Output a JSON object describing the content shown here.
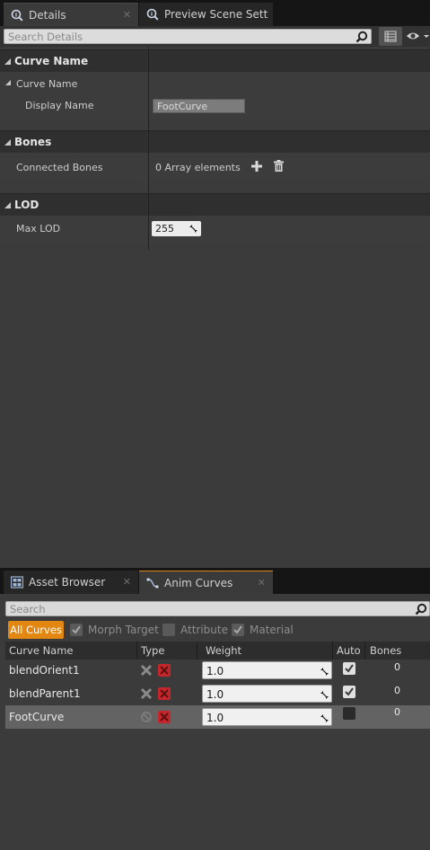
{
  "top_tabs": [
    {
      "label": "Details",
      "icon": "details-info-icon",
      "active": true
    },
    {
      "label": "Preview Scene Sett",
      "icon": "details-info-icon",
      "active": false
    }
  ],
  "details": {
    "search_placeholder": "Search Details",
    "categories": {
      "curve_name": {
        "title": "Curve Name",
        "subgroup": "Curve Name",
        "display_name_label": "Display Name",
        "display_name_value": "FootCurve"
      },
      "bones": {
        "title": "Bones",
        "connected_label": "Connected Bones",
        "connected_value": "0 Array elements"
      },
      "lod": {
        "title": "LOD",
        "max_lod_label": "Max LOD",
        "max_lod_value": "255"
      }
    }
  },
  "bottom_tabs": [
    {
      "label": "Asset Browser",
      "icon": "asset-browser-icon",
      "active": false
    },
    {
      "label": "Anim Curves",
      "icon": "anim-curves-icon",
      "active": true
    }
  ],
  "anim_curves": {
    "search_placeholder": "Search",
    "filters": {
      "all_curves": "All Curves",
      "morph_target": {
        "label": "Morph Target",
        "checked": true
      },
      "attribute": {
        "label": "Attribute",
        "checked": false
      },
      "material": {
        "label": "Material",
        "checked": true
      }
    },
    "columns": [
      "Curve Name",
      "Type",
      "Weight",
      "Auto",
      "Bones"
    ],
    "rows": [
      {
        "name": "blendOrient1",
        "weight": "1.0",
        "auto": true,
        "bones": "0",
        "selected": false
      },
      {
        "name": "blendParent1",
        "weight": "1.0",
        "auto": true,
        "bones": "0",
        "selected": false
      },
      {
        "name": "FootCurve",
        "weight": "1.0",
        "auto": false,
        "bones": "0",
        "selected": true
      }
    ]
  },
  "colors": {
    "accent_orange": "#e28712",
    "material_red": "#c4262b",
    "panel_bg": "#3b3b3b",
    "header_bg": "#2f2f2f"
  }
}
